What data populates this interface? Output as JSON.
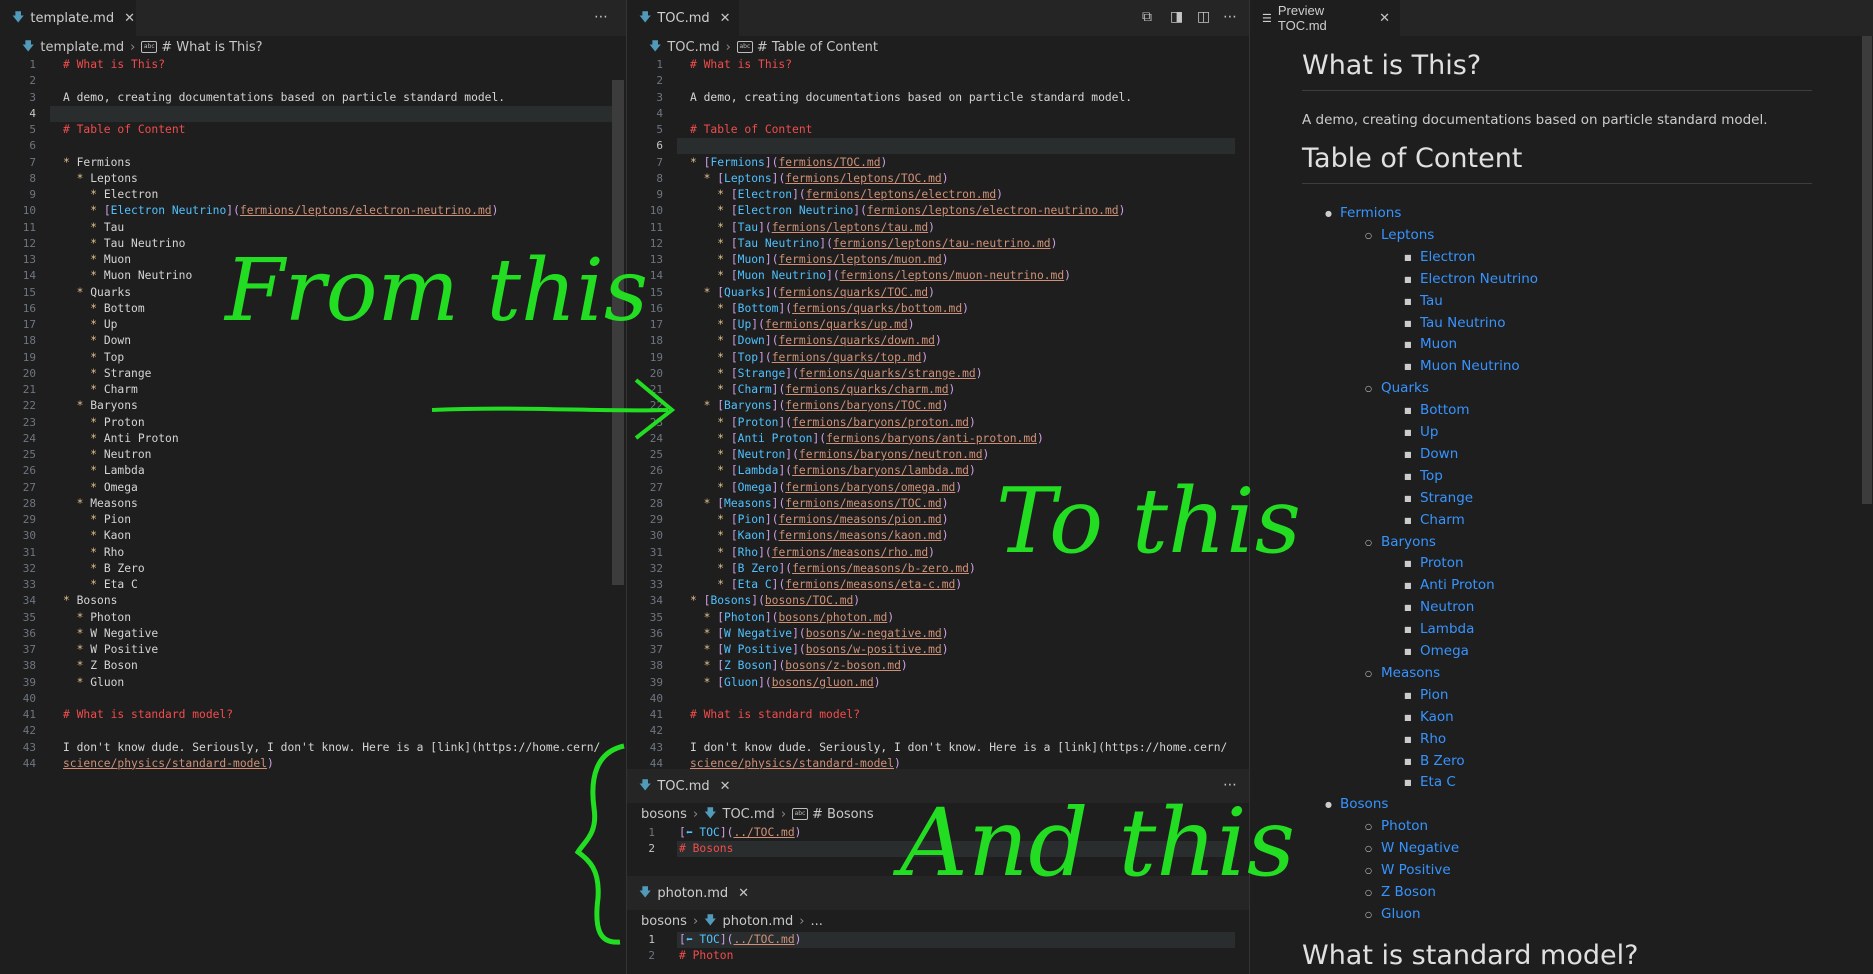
{
  "left_pane": {
    "tab": "template.md",
    "breadcrumb": [
      "template.md",
      "# What is This?"
    ],
    "current_line": 4,
    "lines": [
      "# What is This?",
      "",
      "A demo, creating documentations based on particle standard model.",
      "",
      "# Table of Content",
      "",
      "* Fermions",
      "  * Leptons",
      "    * Electron",
      "    * [Electron Neutrino](fermions/leptons/electron-neutrino.md)",
      "    * Tau",
      "    * Tau Neutrino",
      "    * Muon",
      "    * Muon Neutrino",
      "  * Quarks",
      "    * Bottom",
      "    * Up",
      "    * Down",
      "    * Top",
      "    * Strange",
      "    * Charm",
      "  * Baryons",
      "    * Proton",
      "    * Anti Proton",
      "    * Neutron",
      "    * Lambda",
      "    * Omega",
      "  * Measons",
      "    * Pion",
      "    * Kaon",
      "    * Rho",
      "    * B Zero",
      "    * Eta C",
      "* Bosons",
      "  * Photon",
      "  * W Negative",
      "  * W Positive",
      "  * Z Boson",
      "  * Gluon",
      "",
      "# What is standard model?",
      "",
      "I don't know dude. Seriously, I don't know. Here is a [link](https://home.cern/",
      "science/physics/standard-model)"
    ]
  },
  "middle_pane": {
    "tab": "TOC.md",
    "breadcrumb": [
      "TOC.md",
      "# Table of Content"
    ],
    "current_line": 6,
    "lines": [
      "# What is This?",
      "",
      "A demo, creating documentations based on particle standard model.",
      "",
      "# Table of Content",
      "",
      "* [Fermions](fermions/TOC.md)",
      "  * [Leptons](fermions/leptons/TOC.md)",
      "    * [Electron](fermions/leptons/electron.md)",
      "    * [Electron Neutrino](fermions/leptons/electron-neutrino.md)",
      "    * [Tau](fermions/leptons/tau.md)",
      "    * [Tau Neutrino](fermions/leptons/tau-neutrino.md)",
      "    * [Muon](fermions/leptons/muon.md)",
      "    * [Muon Neutrino](fermions/leptons/muon-neutrino.md)",
      "  * [Quarks](fermions/quarks/TOC.md)",
      "    * [Bottom](fermions/quarks/bottom.md)",
      "    * [Up](fermions/quarks/up.md)",
      "    * [Down](fermions/quarks/down.md)",
      "    * [Top](fermions/quarks/top.md)",
      "    * [Strange](fermions/quarks/strange.md)",
      "    * [Charm](fermions/quarks/charm.md)",
      "  * [Baryons](fermions/baryons/TOC.md)",
      "    * [Proton](fermions/baryons/proton.md)",
      "    * [Anti Proton](fermions/baryons/anti-proton.md)",
      "    * [Neutron](fermions/baryons/neutron.md)",
      "    * [Lambda](fermions/baryons/lambda.md)",
      "    * [Omega](fermions/baryons/omega.md)",
      "  * [Measons](fermions/measons/TOC.md)",
      "    * [Pion](fermions/measons/pion.md)",
      "    * [Kaon](fermions/measons/kaon.md)",
      "    * [Rho](fermions/measons/rho.md)",
      "    * [B Zero](fermions/measons/b-zero.md)",
      "    * [Eta C](fermions/measons/eta-c.md)",
      "* [Bosons](bosons/TOC.md)",
      "  * [Photon](bosons/photon.md)",
      "  * [W Negative](bosons/w-negative.md)",
      "  * [W Positive](bosons/w-positive.md)",
      "  * [Z Boson](bosons/z-boson.md)",
      "  * [Gluon](bosons/gluon.md)",
      "",
      "# What is standard model?",
      "",
      "I don't know dude. Seriously, I don't know. Here is a [link](https://home.cern/",
      "science/physics/standard-model)"
    ]
  },
  "bottom_pane_1": {
    "tab": "TOC.md",
    "breadcrumb": [
      "bosons",
      "TOC.md",
      "# Bosons"
    ],
    "lines": [
      "[⬅ TOC](../TOC.md)",
      "# Bosons"
    ]
  },
  "bottom_pane_2": {
    "tab": "photon.md",
    "breadcrumb": [
      "bosons",
      "photon.md",
      "..."
    ],
    "lines": [
      "[⬅ TOC](../TOC.md)",
      "# Photon"
    ]
  },
  "preview": {
    "tab": "Preview TOC.md",
    "h1_1": "What is This?",
    "p1": "A demo, creating documentations based on particle standard model.",
    "h1_2": "Table of Content",
    "h1_3": "What is standard model?",
    "list": [
      {
        "t": "Fermions",
        "l": 1
      },
      {
        "t": "Leptons",
        "l": 2
      },
      {
        "t": "Electron",
        "l": 3
      },
      {
        "t": "Electron Neutrino",
        "l": 3
      },
      {
        "t": "Tau",
        "l": 3
      },
      {
        "t": "Tau Neutrino",
        "l": 3
      },
      {
        "t": "Muon",
        "l": 3
      },
      {
        "t": "Muon Neutrino",
        "l": 3
      },
      {
        "t": "Quarks",
        "l": 2
      },
      {
        "t": "Bottom",
        "l": 3
      },
      {
        "t": "Up",
        "l": 3
      },
      {
        "t": "Down",
        "l": 3
      },
      {
        "t": "Top",
        "l": 3
      },
      {
        "t": "Strange",
        "l": 3
      },
      {
        "t": "Charm",
        "l": 3
      },
      {
        "t": "Baryons",
        "l": 2
      },
      {
        "t": "Proton",
        "l": 3
      },
      {
        "t": "Anti Proton",
        "l": 3
      },
      {
        "t": "Neutron",
        "l": 3
      },
      {
        "t": "Lambda",
        "l": 3
      },
      {
        "t": "Omega",
        "l": 3
      },
      {
        "t": "Measons",
        "l": 2
      },
      {
        "t": "Pion",
        "l": 3
      },
      {
        "t": "Kaon",
        "l": 3
      },
      {
        "t": "Rho",
        "l": 3
      },
      {
        "t": "B Zero",
        "l": 3
      },
      {
        "t": "Eta C",
        "l": 3
      },
      {
        "t": "Bosons",
        "l": 1
      },
      {
        "t": "Photon",
        "l": 2
      },
      {
        "t": "W Negative",
        "l": 2
      },
      {
        "t": "W Positive",
        "l": 2
      },
      {
        "t": "Z Boson",
        "l": 2
      },
      {
        "t": "Gluon",
        "l": 2
      }
    ]
  },
  "annotations": {
    "from": "From this",
    "to": "To this",
    "and": "And this",
    "color": "#22dd22"
  },
  "icons": {
    "more": "more-actions-icon",
    "close": "close-icon",
    "split": "split-editor-icon",
    "preview": "open-preview-icon"
  }
}
